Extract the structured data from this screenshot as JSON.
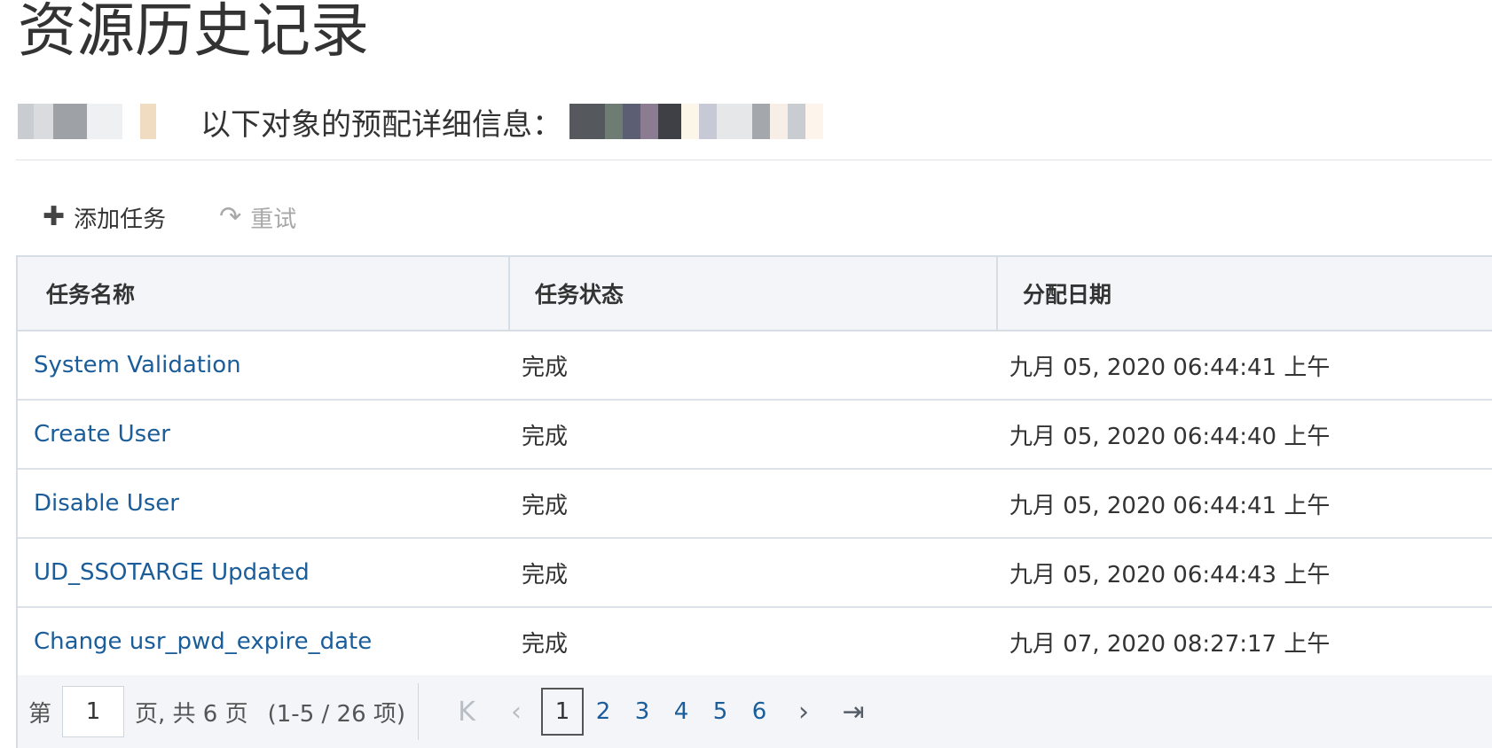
{
  "page": {
    "title": "资源历史记录",
    "subtitle": "以下对象的预配详细信息："
  },
  "toolbar": {
    "add_label": "添加任务",
    "add_icon": "plus-icon",
    "retry_label": "重试",
    "retry_icon": "redo-icon"
  },
  "table": {
    "columns": [
      "任务名称",
      "任务状态",
      "分配日期"
    ],
    "rows": [
      {
        "name": "System Validation",
        "status": "完成",
        "date": "九月 05, 2020 06:44:41 上午"
      },
      {
        "name": "Create User",
        "status": "完成",
        "date": "九月 05, 2020 06:44:40 上午"
      },
      {
        "name": "Disable User",
        "status": "完成",
        "date": "九月 05, 2020 06:44:41 上午"
      },
      {
        "name": "UD_SSOTARGE Updated",
        "status": "完成",
        "date": "九月 05, 2020 06:44:43 上午"
      },
      {
        "name": "Change usr_pwd_expire_date",
        "status": "完成",
        "date": "九月 07, 2020 08:27:17 上午"
      }
    ]
  },
  "pager": {
    "prefix": "第",
    "current_page": "1",
    "suffix": "页, 共 6 页",
    "summary": "(1-5 / 26 项)",
    "pages": [
      "1",
      "2",
      "3",
      "4",
      "5",
      "6"
    ],
    "first_icon": "first-page-icon",
    "prev_icon": "prev-page-icon",
    "next_icon": "next-page-icon",
    "last_icon": "last-page-icon"
  },
  "colors": {
    "link": "#1a5d9a",
    "header_bg": "#f3f5f8",
    "border": "#d7dde4"
  }
}
